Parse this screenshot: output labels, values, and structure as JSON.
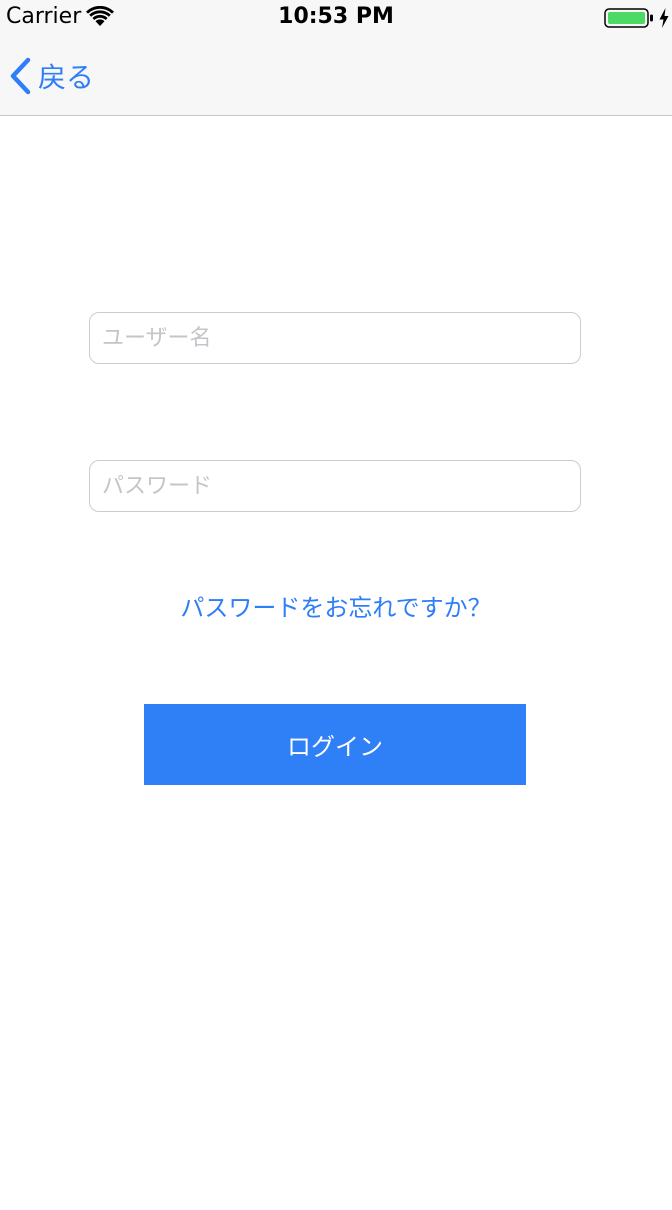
{
  "status_bar": {
    "carrier": "Carrier",
    "time": "10:53 PM",
    "battery_level": 1.0,
    "charging": true,
    "icons": [
      "wifi-icon",
      "battery-icon",
      "charging-icon"
    ]
  },
  "nav_bar": {
    "back_label": "戻る",
    "back_icon": "chevron-left-icon"
  },
  "form": {
    "username_placeholder": "ユーザー名",
    "username_value": "",
    "password_placeholder": "パスワード",
    "password_value": "",
    "forgot_password_label": "パスワードをお忘れですか？",
    "login_label": "ログイン"
  },
  "colors": {
    "accent": "#2e7ef7",
    "button": "#2f7ff7",
    "battery_fill": "#4cd964",
    "bar_background": "#f7f7f7"
  }
}
